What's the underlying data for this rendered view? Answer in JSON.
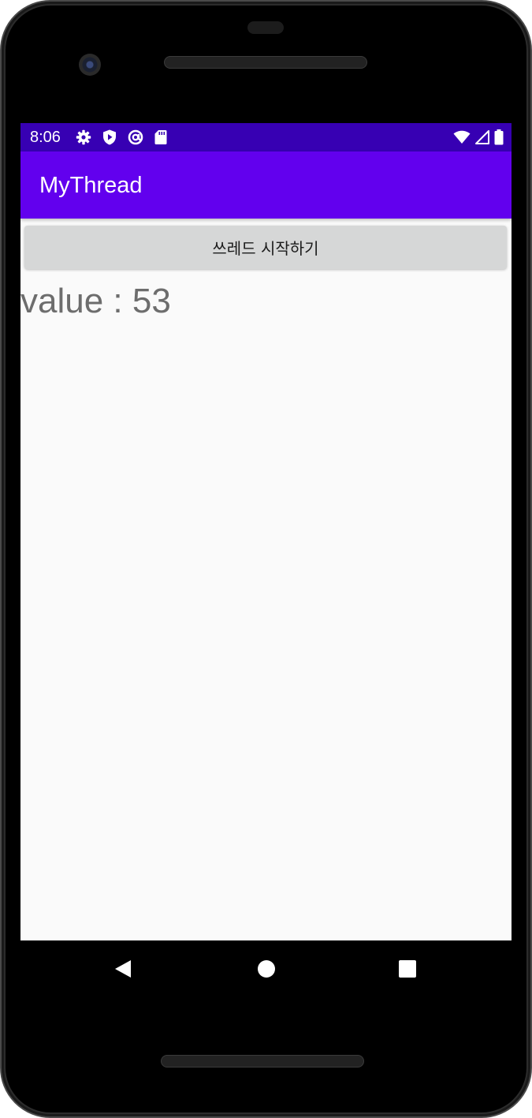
{
  "status_bar": {
    "time": "8:06",
    "left_icons": [
      "gear-icon",
      "shield-play-icon",
      "at-sign-icon",
      "sd-card-icon"
    ],
    "right_icons": [
      "wifi-icon",
      "signal-icon",
      "battery-icon"
    ],
    "background": "#3700b3"
  },
  "app_bar": {
    "title": "MyThread",
    "background": "#6200ee"
  },
  "main": {
    "start_button_label": "쓰레드 시작하기",
    "value_text": "value : 53"
  },
  "nav_bar": {
    "buttons": [
      "back-icon",
      "home-icon",
      "recents-icon"
    ]
  }
}
